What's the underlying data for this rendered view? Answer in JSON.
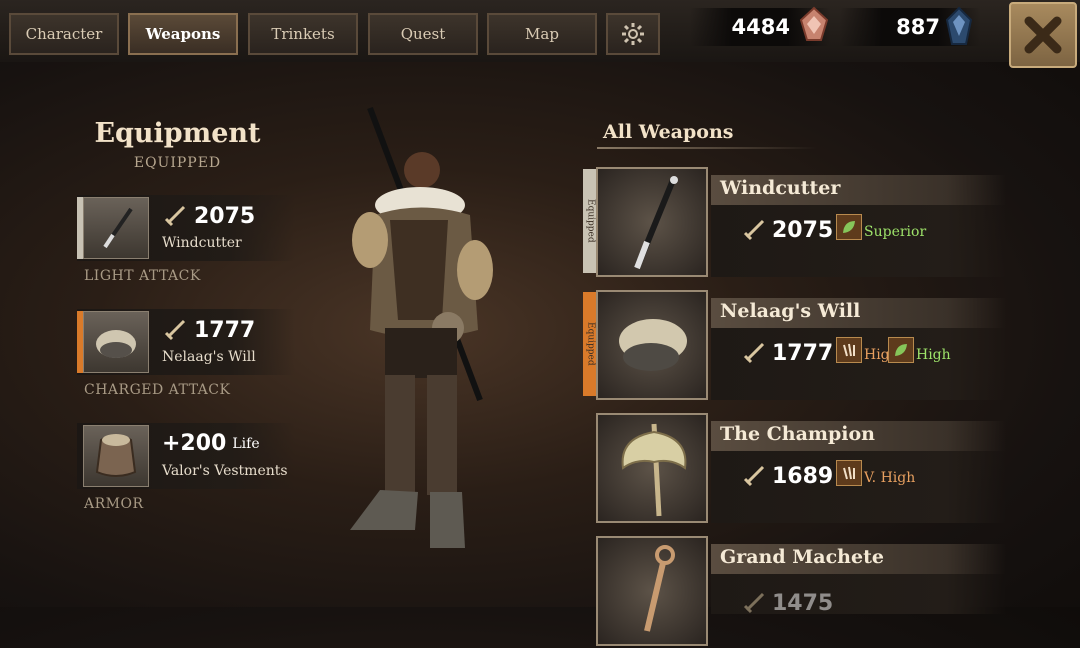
{
  "tabs": [
    {
      "label": "Character"
    },
    {
      "label": "Weapons"
    },
    {
      "label": "Trinkets"
    },
    {
      "label": "Quest"
    },
    {
      "label": "Map"
    }
  ],
  "currencies": [
    {
      "value": "4484",
      "icon": "gem-red-icon"
    },
    {
      "value": "887",
      "icon": "gem-blue-icon"
    }
  ],
  "equipment": {
    "title": "Equipment",
    "subtitle": "EQUIPPED",
    "slots": [
      {
        "value": "2075",
        "name": "Windcutter",
        "label": "LIGHT ATTACK"
      },
      {
        "value": "1777",
        "name": "Nelaag's Will",
        "label": "CHARGED ATTACK"
      },
      {
        "value": "+200",
        "suffix": "Life",
        "name": "Valor's Vestments",
        "label": "ARMOR"
      }
    ]
  },
  "weapons": {
    "title": "All Weapons",
    "items": [
      {
        "name": "Windcutter",
        "value": "2075",
        "tag": "Equipped",
        "badges": [
          {
            "text": "Superior",
            "color": "#9ee36a"
          }
        ]
      },
      {
        "name": "Nelaag's Will",
        "value": "1777",
        "tag": "Equipped",
        "badges": [
          {
            "text": "High",
            "color": "#e8a060"
          },
          {
            "text": "High",
            "color": "#9ee36a"
          }
        ]
      },
      {
        "name": "The Champion",
        "value": "1689",
        "badges": [
          {
            "text": "V. High",
            "color": "#e8a060"
          }
        ]
      },
      {
        "name": "Grand Machete",
        "value": "1475"
      }
    ]
  },
  "colors": {
    "accent_orange": "#d97a2a",
    "rating_green": "#9ee36a",
    "rating_orange": "#e8a060"
  }
}
